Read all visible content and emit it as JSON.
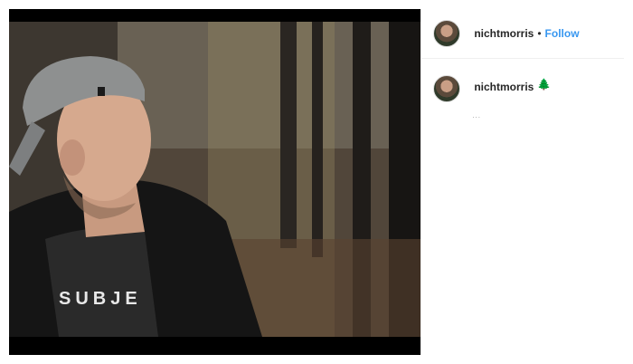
{
  "post": {
    "header": {
      "username": "nichtmorris",
      "separator": "•",
      "follow_label": "Follow"
    },
    "caption": {
      "username": "nichtmorris",
      "emoji_icon": "evergreen-tree-icon",
      "emoji": "🌲",
      "text": "..."
    },
    "photo": {
      "shirt_text": "SUBJE"
    }
  }
}
